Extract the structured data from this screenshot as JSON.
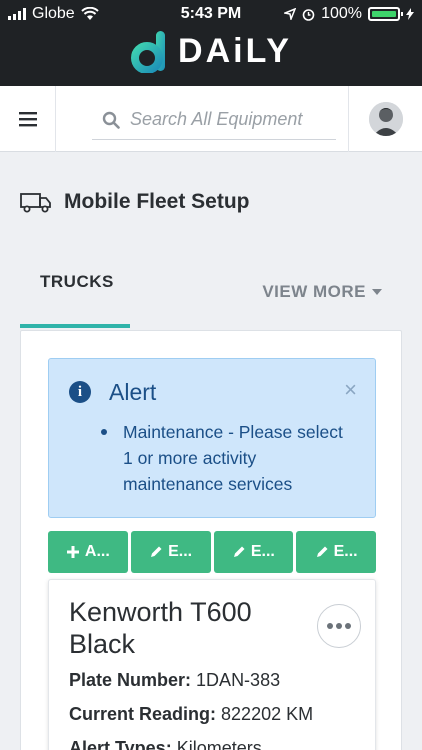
{
  "status_bar": {
    "carrier": "Globe",
    "time": "5:43 PM",
    "battery": "100%"
  },
  "app": {
    "wordmark": "DAiLY"
  },
  "header": {
    "search_placeholder": "Search All Equipment"
  },
  "page": {
    "title": "Mobile Fleet Setup"
  },
  "tabs": {
    "trucks_label": "TRUCKS",
    "view_more_label": "VIEW MORE"
  },
  "alert": {
    "title": "Alert",
    "close": "×",
    "messages": [
      "Maintenance - Please select 1 or more activity maintenance services"
    ]
  },
  "actions": [
    {
      "label": "A...",
      "icon": "plus-icon"
    },
    {
      "label": "E...",
      "icon": "pencil-icon"
    },
    {
      "label": "E...",
      "icon": "pencil-icon"
    },
    {
      "label": "E...",
      "icon": "pencil-icon"
    }
  ],
  "truck": {
    "name": "Kenworth T600 Black",
    "plate_label": "Plate Number:",
    "plate_value": "1DAN-383",
    "reading_label": "Current Reading:",
    "reading_value": "822202 KM",
    "alert_types_label": "Alert Types:",
    "alert_types_value": "Kilometers"
  },
  "colors": {
    "accent_teal": "#2fb3a9",
    "action_green": "#3fb983",
    "alert_bg": "#cfe6fb",
    "topbar": "#1f2225"
  }
}
